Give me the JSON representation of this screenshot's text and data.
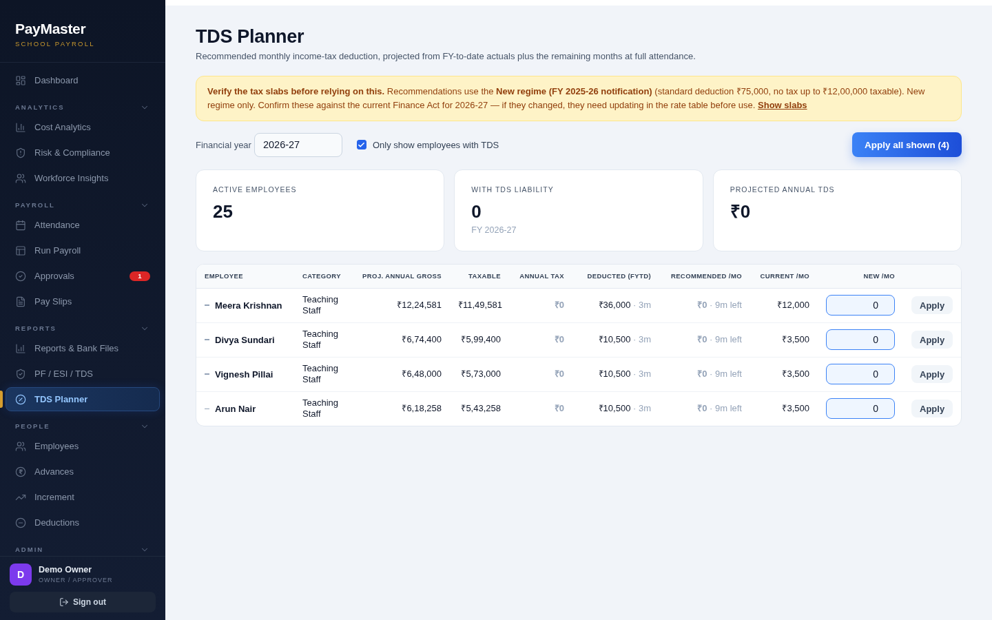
{
  "sidebar": {
    "brand": "PayMaster",
    "tagline": "SCHOOL PAYROLL",
    "items": [
      {
        "label": "Dashboard",
        "selected": false
      }
    ],
    "sections": [
      {
        "title": "ANALYTICS",
        "expanded": true,
        "items": [
          {
            "label": "Cost Analytics",
            "selected": false
          },
          {
            "label": "Risk & Compliance",
            "selected": false
          },
          {
            "label": "Workforce Insights",
            "selected": false
          }
        ]
      },
      {
        "title": "PAYROLL",
        "expanded": true,
        "items": [
          {
            "label": "Attendance",
            "selected": false
          },
          {
            "label": "Run Payroll",
            "selected": false
          },
          {
            "label": "Approvals",
            "selected": false,
            "badge": "1"
          },
          {
            "label": "Pay Slips",
            "selected": false
          }
        ]
      },
      {
        "title": "REPORTS",
        "expanded": true,
        "items": [
          {
            "label": "Reports & Bank Files",
            "selected": false
          },
          {
            "label": "PF / ESI / TDS",
            "selected": false
          },
          {
            "label": "TDS Planner",
            "selected": true
          }
        ]
      },
      {
        "title": "PEOPLE",
        "expanded": true,
        "items": [
          {
            "label": "Employees",
            "selected": false
          },
          {
            "label": "Advances",
            "selected": false
          },
          {
            "label": "Increment",
            "selected": false
          },
          {
            "label": "Deductions",
            "selected": false
          }
        ]
      },
      {
        "title": "ADMIN",
        "expanded": true
      }
    ],
    "user": {
      "initial": "D",
      "name": "Demo Owner",
      "role": "OWNER / APPROVER"
    },
    "sign_out": "Sign out"
  },
  "page": {
    "title": "TDS Planner",
    "subtitle": "Recommended monthly income-tax deduction, projected from FY-to-date actuals plus the remaining months at full attendance."
  },
  "notice": {
    "text": "**Verify the tax slabs before relying on this.** Recommendations use the **New regime (FY 2025-26 notification)** (standard deduction ₹75,000, no tax up to ₹12,00,000 taxable). New regime only. Confirm these against the current Finance Act for 2026-27 — if they changed, they need updating in the rate table before use.",
    "link": "Show slabs"
  },
  "controls": {
    "financial_year": {
      "label": "Financial year",
      "value": "2026-27"
    },
    "filter": {
      "label": "Only show employees with TDS",
      "checked": true
    },
    "apply_all": "Apply all shown (4)"
  },
  "stats": [
    {
      "label": "ACTIVE EMPLOYEES",
      "value": "25"
    },
    {
      "label": "WITH TDS LIABILITY",
      "value": "0",
      "note": "FY 2026-27"
    },
    {
      "label": "PROJECTED ANNUAL TDS",
      "value": "₹0"
    }
  ],
  "table": {
    "columns": [
      "EMPLOYEE",
      "CATEGORY",
      "PROJ. ANNUAL GROSS",
      "TAXABLE",
      "ANNUAL TAX",
      "DEDUCTED (FYTD)",
      "RECOMMENDED /MO",
      "CURRENT /MO",
      "NEW /MO"
    ],
    "rows": [
      {
        "employee": "Meera Krishnan",
        "category": "Teaching Staff",
        "proj_annual_gross": "₹12,24,581",
        "taxable": "₹11,49,581",
        "annual_tax": "₹0",
        "deducted": {
          "amount": "₹36,000",
          "note": "· 3m"
        },
        "recommended": {
          "amount": "₹0",
          "note": "· 9m left"
        },
        "current": "₹12,000",
        "new": "0",
        "action": "Apply"
      },
      {
        "employee": "Divya Sundari",
        "category": "Teaching Staff",
        "proj_annual_gross": "₹6,74,400",
        "taxable": "₹5,99,400",
        "annual_tax": "₹0",
        "deducted": {
          "amount": "₹10,500",
          "note": "· 3m"
        },
        "recommended": {
          "amount": "₹0",
          "note": "· 9m left"
        },
        "current": "₹3,500",
        "new": "0",
        "action": "Apply"
      },
      {
        "employee": "Vignesh Pillai",
        "category": "Teaching Staff",
        "proj_annual_gross": "₹6,48,000",
        "taxable": "₹5,73,000",
        "annual_tax": "₹0",
        "deducted": {
          "amount": "₹10,500",
          "note": "· 3m"
        },
        "recommended": {
          "amount": "₹0",
          "note": "· 9m left"
        },
        "current": "₹3,500",
        "new": "0",
        "action": "Apply"
      },
      {
        "employee": "Arun Nair",
        "category": "Teaching Staff",
        "proj_annual_gross": "₹6,18,258",
        "taxable": "₹5,43,258",
        "annual_tax": "₹0",
        "deducted": {
          "amount": "₹10,500",
          "note": "· 3m"
        },
        "recommended": {
          "amount": "₹0",
          "note": "· 9m left"
        },
        "current": "₹3,500",
        "new": "0",
        "action": "Apply"
      }
    ]
  }
}
